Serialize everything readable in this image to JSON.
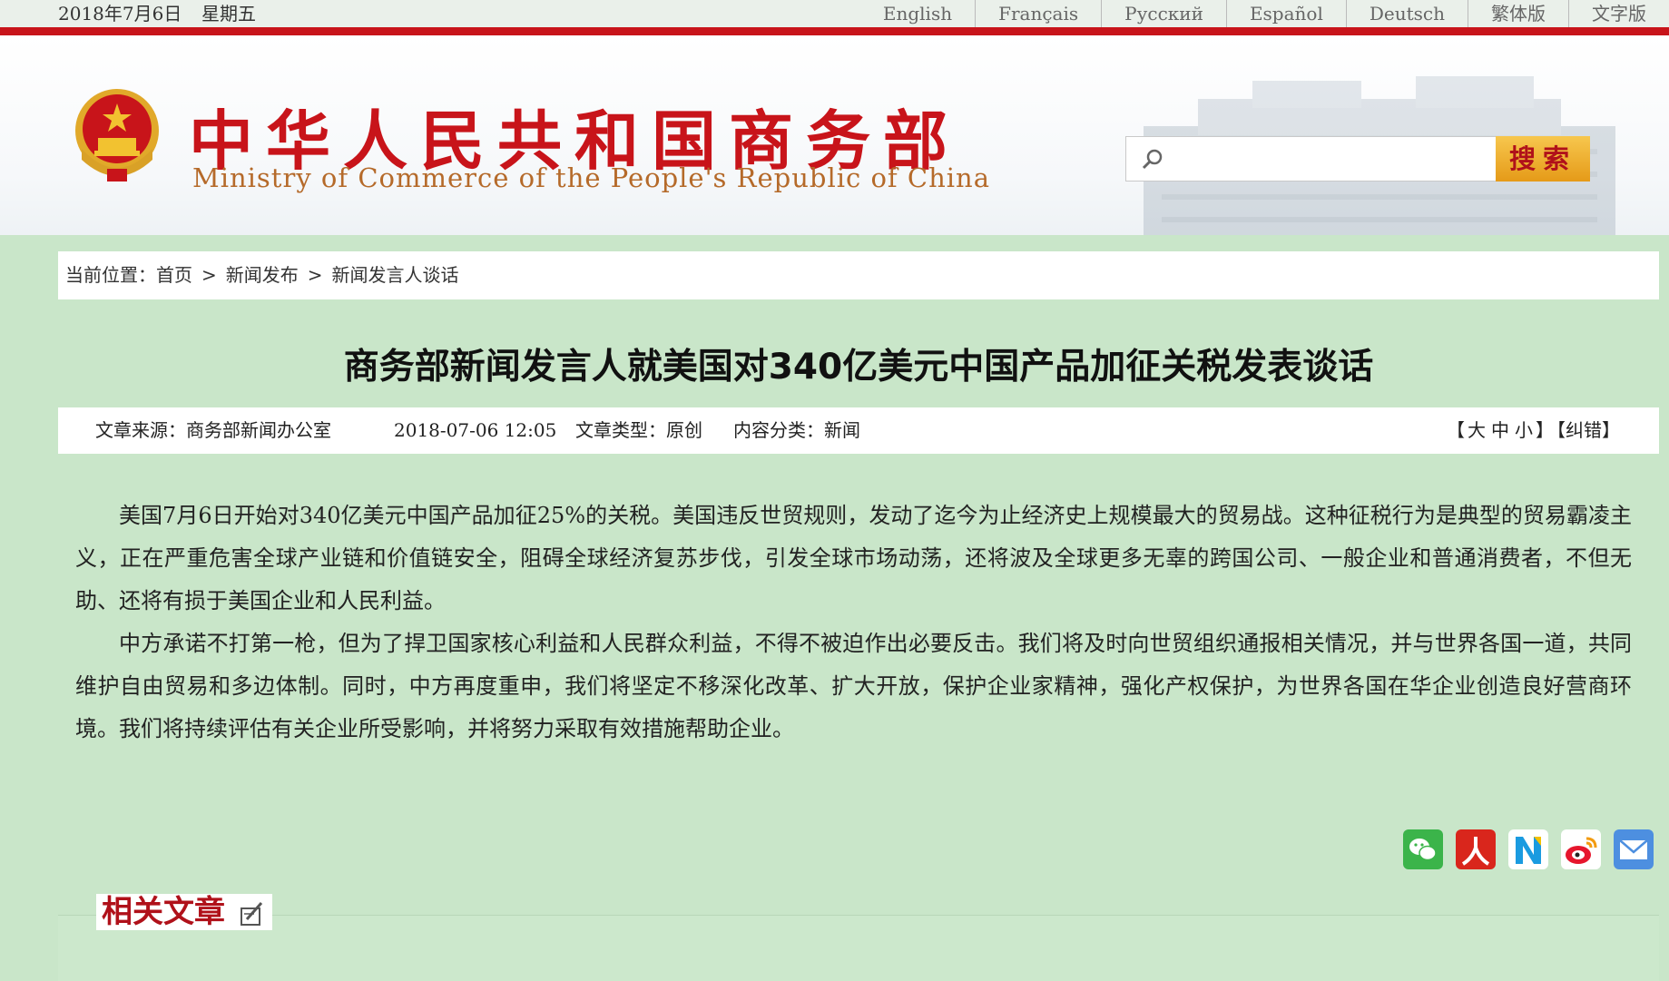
{
  "topbar": {
    "date": "2018年7月6日",
    "weekday": "星期五",
    "languages": [
      "English",
      "Français",
      "Русский",
      "Español",
      "Deutsch",
      "繁体版",
      "文字版"
    ]
  },
  "header": {
    "title_cn": "中华人民共和国商务部",
    "title_en": "Ministry of Commerce of the People's Republic of China",
    "search": {
      "placeholder": "",
      "button": "搜索"
    }
  },
  "breadcrumb": {
    "prefix": "当前位置：",
    "items": [
      "首页",
      "新闻发布",
      "新闻发言人谈话"
    ],
    "separator": ">"
  },
  "article": {
    "title": "商务部新闻发言人就美国对340亿美元中国产品加征关税发表谈话",
    "meta": {
      "source": "文章来源：商务部新闻办公室",
      "time": "2018-07-06 12:05",
      "type": "文章类型：原创",
      "category": "内容分类：新闻",
      "size_open": "【",
      "size_large": "大",
      "size_medium": "中",
      "size_small": "小",
      "size_close": "】",
      "correction": "【纠错】"
    },
    "paragraphs": [
      "美国7月6日开始对340亿美元中国产品加征25%的关税。美国违反世贸规则，发动了迄今为止经济史上规模最大的贸易战。这种征税行为是典型的贸易霸凌主义，正在严重危害全球产业链和价值链安全，阻碍全球经济复苏步伐，引发全球市场动荡，还将波及全球更多无辜的跨国公司、一般企业和普通消费者，不但无助、还将有损于美国企业和人民利益。",
      "中方承诺不打第一枪，但为了捍卫国家核心利益和人民群众利益，不得不被迫作出必要反击。我们将及时向世贸组织通报相关情况，并与世界各国一道，共同维护自由贸易和多边体制。同时，中方再度重申，我们将坚定不移深化改革、扩大开放，保护企业家精神，强化产权保护，为世界各国在华企业创造良好营商环境。我们将持续评估有关企业所受影响，并将努力采取有效措施帮助企业。"
    ]
  },
  "share": {
    "icons": [
      "wechat-icon",
      "renren-icon",
      "n-share-icon",
      "weibo-icon",
      "email-icon"
    ]
  },
  "related": {
    "title": "相关文章"
  },
  "colors": {
    "page_bg": "#c9e6c9",
    "brand_red": "#c8141a",
    "search_btn": "#f2b233"
  }
}
